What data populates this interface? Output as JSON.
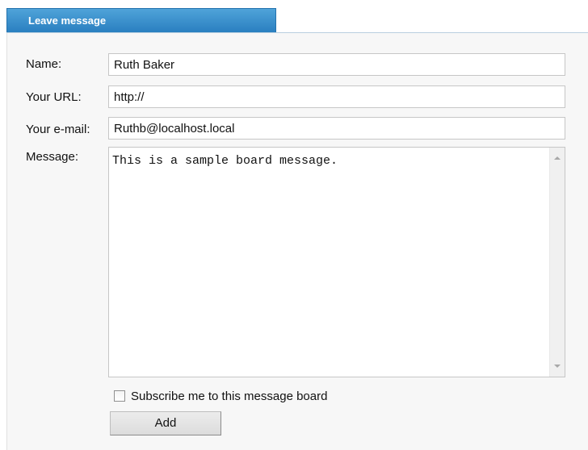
{
  "header": {
    "tab_title": "Leave message"
  },
  "form": {
    "name": {
      "label": "Name:",
      "value": "Ruth Baker"
    },
    "url": {
      "label": "Your URL:",
      "value": "http://"
    },
    "email": {
      "label": "Your e-mail:",
      "value": "Ruthb@localhost.local"
    },
    "message": {
      "label": "Message:",
      "value": "This is a sample board message."
    },
    "subscribe": {
      "label": "Subscribe me to this message board",
      "checked": false
    },
    "submit_label": "Add"
  },
  "colors": {
    "tab_blue": "#2a7fc0",
    "panel_bg": "#f7f7f7"
  }
}
